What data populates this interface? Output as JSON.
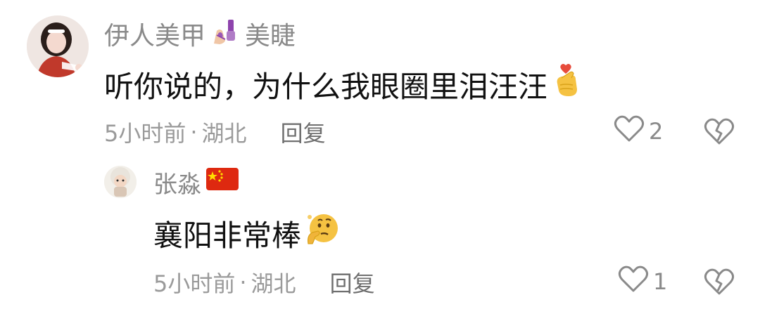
{
  "comments": [
    {
      "username": "伊人美甲",
      "username_suffix": "美睫",
      "username_emoji": "nail-polish-icon",
      "text": "听你说的，为什么我眼圈里泪汪汪",
      "text_emoji": "finger-heart-icon",
      "time": "5小时前",
      "separator": "·",
      "location": "湖北",
      "reply_label": "回复",
      "like_count": "2"
    },
    {
      "username": "张淼",
      "username_emoji": "china-flag-icon",
      "text": "襄阳非常棒",
      "text_emoji": "thinking-face-icon",
      "time": "5小时前",
      "separator": "·",
      "location": "湖北",
      "reply_label": "回复",
      "like_count": "1"
    }
  ],
  "colors": {
    "username": "#8a8a8a",
    "text": "#111111",
    "meta": "#9a9a9a",
    "flag_red": "#de2910",
    "flag_yellow": "#ffde00"
  }
}
